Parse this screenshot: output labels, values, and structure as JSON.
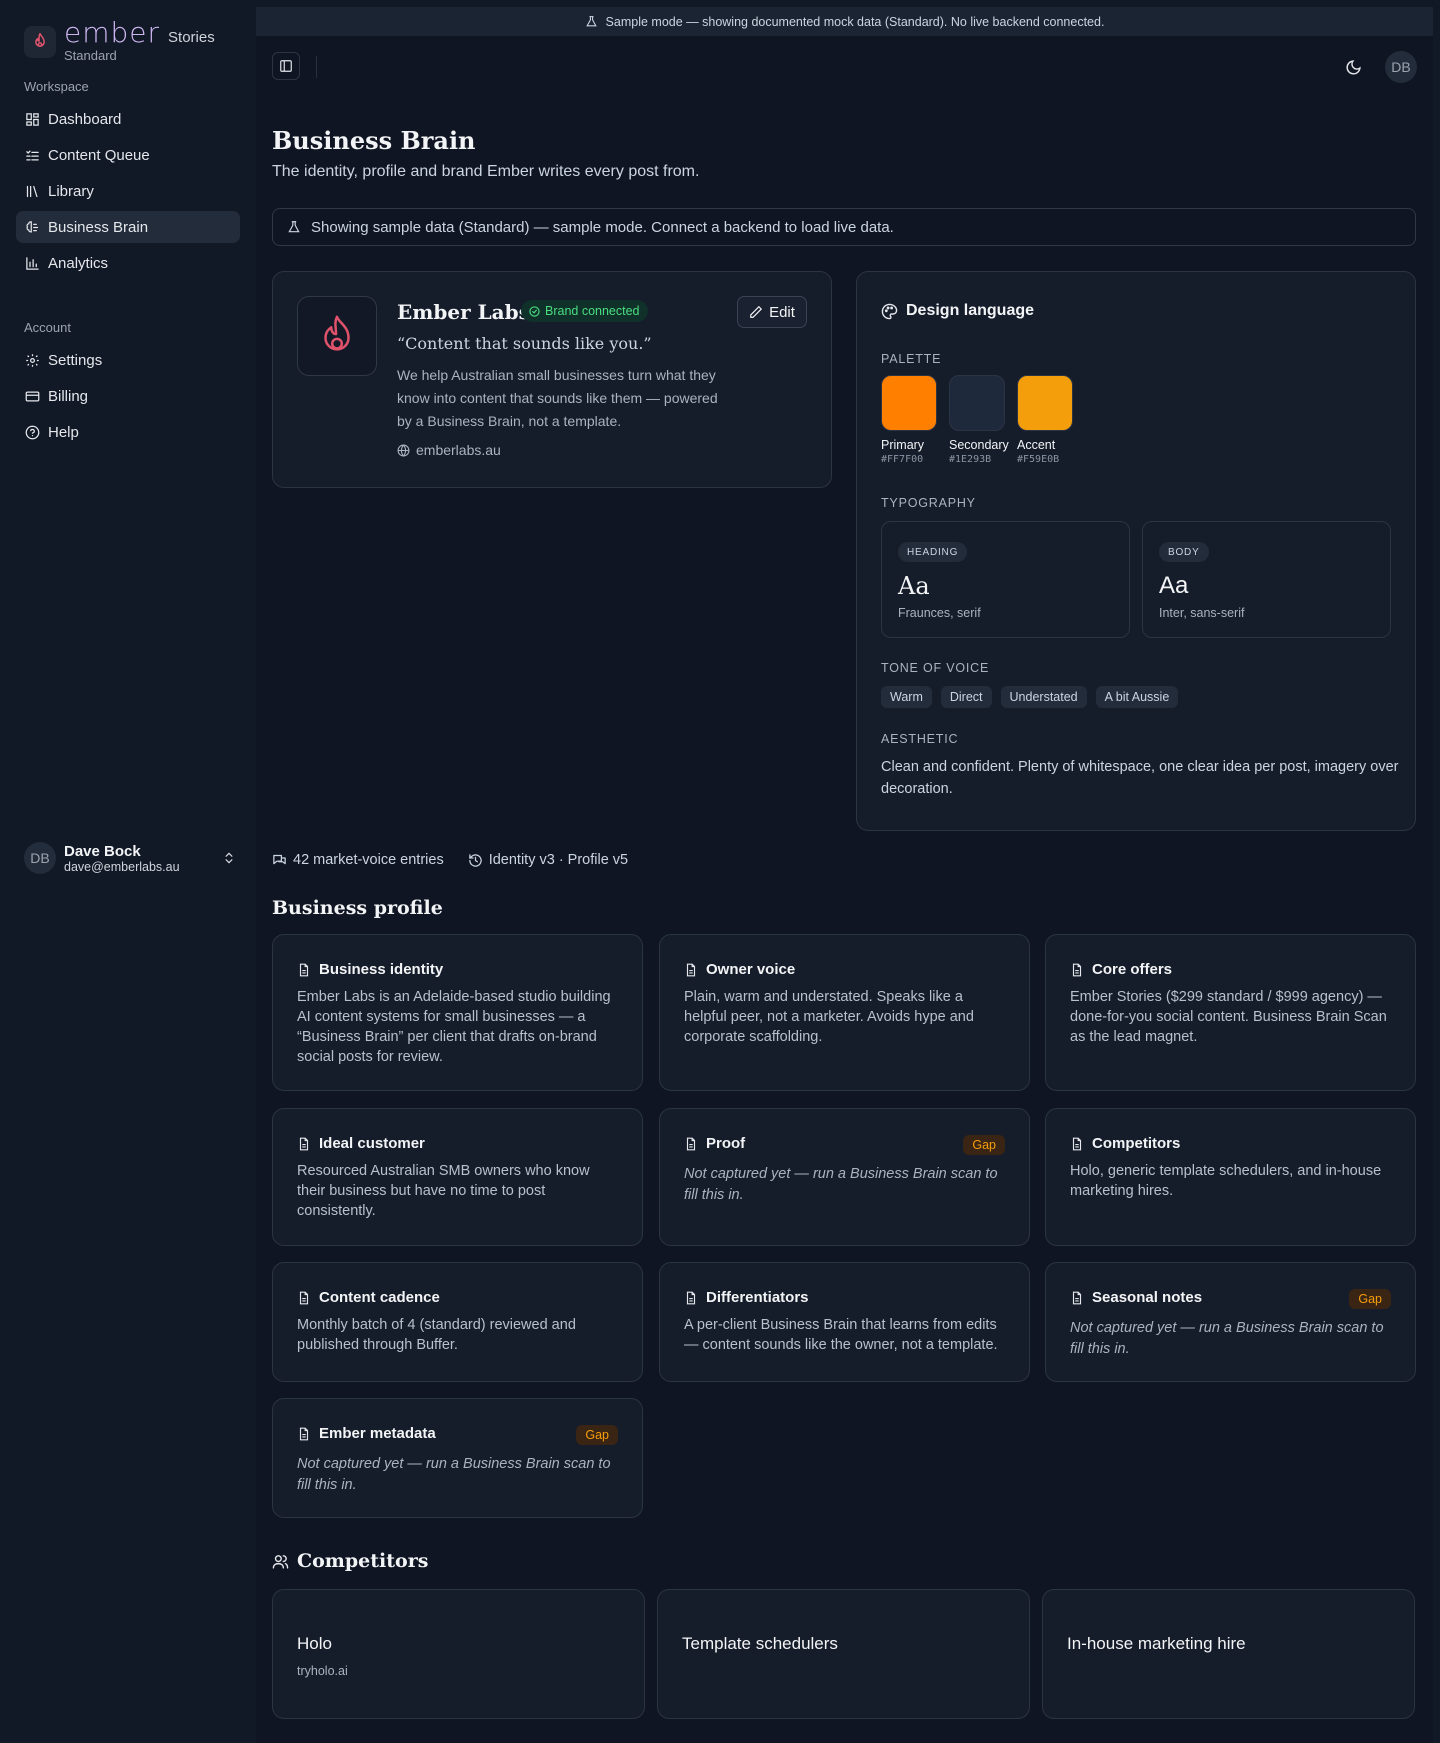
{
  "sidebar": {
    "brand_name": "ember",
    "brand_suffix": "Stories",
    "brand_tier": "Standard",
    "sections": {
      "workspace": "Workspace",
      "account": "Account"
    },
    "workspace_items": [
      {
        "label": "Dashboard",
        "icon": "dashboard-icon"
      },
      {
        "label": "Content Queue",
        "icon": "list-icon"
      },
      {
        "label": "Library",
        "icon": "library-icon"
      },
      {
        "label": "Business Brain",
        "icon": "brain-icon",
        "active": true
      },
      {
        "label": "Analytics",
        "icon": "chart-icon"
      }
    ],
    "account_items": [
      {
        "label": "Settings",
        "icon": "gear-icon"
      },
      {
        "label": "Billing",
        "icon": "card-icon"
      },
      {
        "label": "Help",
        "icon": "help-icon"
      }
    ],
    "user": {
      "initials": "DB",
      "name": "Dave Bock",
      "email": "dave@emberlabs.au"
    }
  },
  "sample_bar": "Sample mode — showing documented mock data (Standard). No live backend connected.",
  "topbar": {
    "avatar_initials": "DB"
  },
  "page": {
    "title": "Business Brain",
    "subtitle": "The identity, profile and brand Ember writes every post from."
  },
  "banner": "Showing sample data (Standard) — sample mode. Connect a backend to load live data.",
  "brand_card": {
    "name": "Ember Labs",
    "badge": "Brand connected",
    "edit_label": "Edit",
    "tagline": "“Content that sounds like you.”",
    "description": "We help Australian small businesses turn what they know into content that sounds like them — powered by a Business Brain, not a template.",
    "url": "emberlabs.au"
  },
  "design_language": {
    "title": "Design language",
    "palette_label": "PALETTE",
    "palette": [
      {
        "name": "Primary",
        "hex": "#FF7F00"
      },
      {
        "name": "Secondary",
        "hex": "#1E293B"
      },
      {
        "name": "Accent",
        "hex": "#F59E0B"
      }
    ],
    "typography_label": "TYPOGRAPHY",
    "typography": [
      {
        "role": "HEADING",
        "sample": "Aa",
        "font": "Fraunces, serif"
      },
      {
        "role": "BODY",
        "sample": "Aa",
        "font": "Inter, sans-serif"
      }
    ],
    "tone_label": "TONE OF VOICE",
    "tones": [
      "Warm",
      "Direct",
      "Understated",
      "A bit Aussie"
    ],
    "aesthetic_label": "AESTHETIC",
    "aesthetic": "Clean and confident. Plenty of whitespace, one clear idea per post, imagery over decoration."
  },
  "meta": {
    "entries": "42 market-voice entries",
    "version": "Identity v3 · Profile v5"
  },
  "profile": {
    "title": "Business profile",
    "gap_label": "Gap",
    "cards": [
      {
        "title": "Business identity",
        "body": "Ember Labs is an Adelaide-based studio building AI content systems for small businesses — a “Business Brain” per client that drafts on-brand social posts for review."
      },
      {
        "title": "Owner voice",
        "body": "Plain, warm and understated. Speaks like a helpful peer, not a marketer. Avoids hype and corporate scaffolding."
      },
      {
        "title": "Core offers",
        "body": "Ember Stories ($299 standard / $999 agency) — done-for-you social content. Business Brain Scan as the lead magnet."
      },
      {
        "title": "Ideal customer",
        "body": "Resourced Australian SMB owners who know their business but have no time to post consistently."
      },
      {
        "title": "Proof",
        "body": "Not captured yet — run a Business Brain scan to fill this in.",
        "gap": true
      },
      {
        "title": "Competitors",
        "body": "Holo, generic template schedulers, and in-house marketing hires."
      },
      {
        "title": "Content cadence",
        "body": "Monthly batch of 4 (standard) reviewed and published through Buffer."
      },
      {
        "title": "Differentiators",
        "body": "A per-client Business Brain that learns from edits — content sounds like the owner, not a template."
      },
      {
        "title": "Seasonal notes",
        "body": "Not captured yet — run a Business Brain scan to fill this in.",
        "gap": true
      },
      {
        "title": "Ember metadata",
        "body": "Not captured yet — run a Business Brain scan to fill this in.",
        "gap": true
      }
    ]
  },
  "competitors": {
    "title": "Competitors",
    "items": [
      {
        "name": "Holo",
        "url": "tryholo.ai"
      },
      {
        "name": "Template schedulers",
        "url": ""
      },
      {
        "name": "In-house marketing hire",
        "url": ""
      }
    ]
  },
  "colors": {
    "background": "#111826",
    "card": "#151c2a",
    "border": "#2b3444",
    "brand_purple": "#cdb6f0",
    "success": "#4ade80",
    "gap": "#f59e0b"
  }
}
